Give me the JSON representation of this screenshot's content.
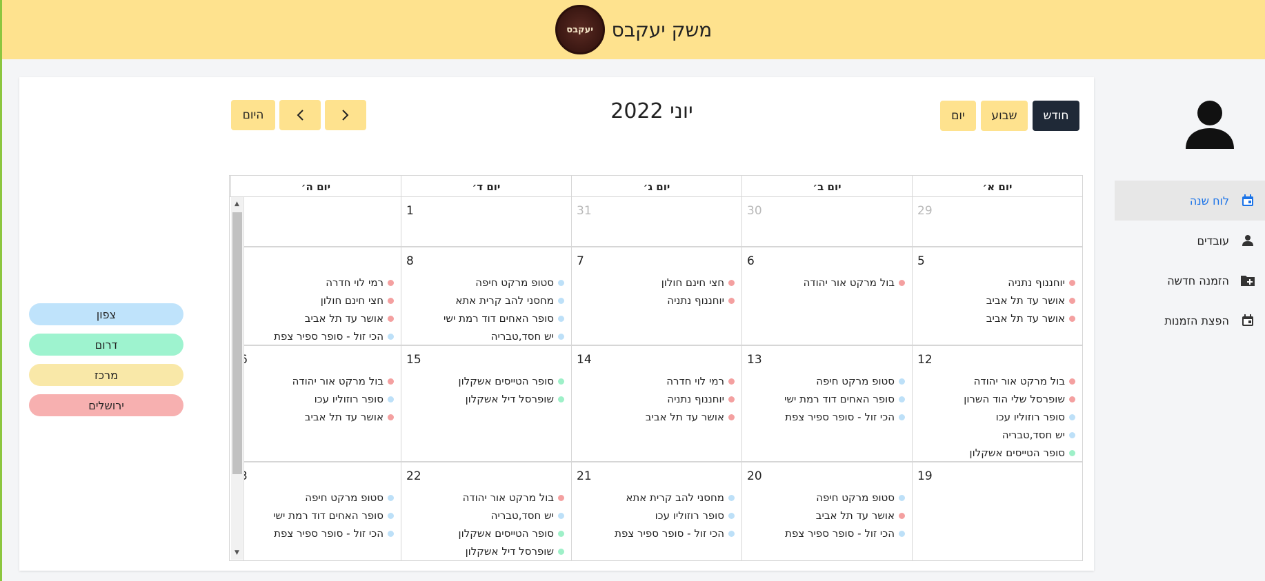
{
  "header": {
    "title": "משק יעקבס",
    "logo_text": "יעקבס"
  },
  "sidebar": {
    "items": [
      {
        "label": "לוח שנה",
        "icon": "calendar-icon",
        "active": true
      },
      {
        "label": "עובדים",
        "icon": "person-icon",
        "active": false
      },
      {
        "label": "הזמנה חדשה",
        "icon": "folder-add-icon",
        "active": false
      },
      {
        "label": "הפצת הזמנות",
        "icon": "event-icon",
        "active": false
      }
    ]
  },
  "toolbar": {
    "month": "חודש",
    "week": "שבוע",
    "day": "יום",
    "title": "יוני 2022",
    "today": "היום"
  },
  "legend": [
    {
      "label": "צפון",
      "color": "#bfe3fb"
    },
    {
      "label": "דרום",
      "color": "#9ef3cf"
    },
    {
      "label": "מרכז",
      "color": "#f9e8a8"
    },
    {
      "label": "ירושלים",
      "color": "#f7b0b0"
    }
  ],
  "colors": {
    "red": "#f4a0a0",
    "blue": "#bde0f8",
    "green": "#9ef0c8"
  },
  "calendar": {
    "headers": [
      "יום א׳",
      "יום ב׳",
      "יום ג׳",
      "יום ד׳",
      "יום ה׳"
    ],
    "weeks": [
      [
        {
          "num": "29",
          "muted": true,
          "events": []
        },
        {
          "num": "30",
          "muted": true,
          "events": []
        },
        {
          "num": "31",
          "muted": true,
          "events": []
        },
        {
          "num": "1",
          "muted": false,
          "events": []
        },
        {
          "num": "",
          "muted": false,
          "events": []
        }
      ],
      [
        {
          "num": "5",
          "events": [
            {
              "t": "יוחננוף נתניה",
              "c": "red"
            },
            {
              "t": "אושר עד תל אביב",
              "c": "red"
            },
            {
              "t": "אושר עד תל אביב",
              "c": "red"
            }
          ]
        },
        {
          "num": "6",
          "events": [
            {
              "t": "בול מרקט אור יהודה",
              "c": "red"
            }
          ]
        },
        {
          "num": "7",
          "events": [
            {
              "t": "חצי חינם חולון",
              "c": "red"
            },
            {
              "t": "יוחננוף נתניה",
              "c": "red"
            }
          ]
        },
        {
          "num": "8",
          "events": [
            {
              "t": "סטופ מרקט חיפה",
              "c": "blue"
            },
            {
              "t": "מחסני להב קרית אתא",
              "c": "blue"
            },
            {
              "t": "סופר האחים דוד רמת ישי",
              "c": "blue"
            },
            {
              "t": "יש חסד,טבריה",
              "c": "blue"
            }
          ]
        },
        {
          "num": "",
          "events": [
            {
              "t": "רמי לוי חדרה",
              "c": "red"
            },
            {
              "t": "חצי חינם חולון",
              "c": "red"
            },
            {
              "t": "אושר עד תל אביב",
              "c": "red"
            },
            {
              "t": "הכי זול - סופר ספיר צפת",
              "c": "blue"
            }
          ]
        }
      ],
      [
        {
          "num": "12",
          "events": [
            {
              "t": "בול מרקט אור יהודה",
              "c": "red"
            },
            {
              "t": "שופרסל שלי הוד השרון",
              "c": "red"
            },
            {
              "t": "סופר רוזוליו עכו",
              "c": "blue"
            },
            {
              "t": "יש חסד,טבריה",
              "c": "blue"
            },
            {
              "t": "סופר הטייסים אשקלון",
              "c": "green"
            }
          ]
        },
        {
          "num": "13",
          "events": [
            {
              "t": "סטופ מרקט חיפה",
              "c": "blue"
            },
            {
              "t": "סופר האחים דוד רמת ישי",
              "c": "blue"
            },
            {
              "t": "הכי זול - סופר ספיר צפת",
              "c": "blue"
            }
          ]
        },
        {
          "num": "14",
          "events": [
            {
              "t": "רמי לוי חדרה",
              "c": "red"
            },
            {
              "t": "יוחננוף נתניה",
              "c": "red"
            },
            {
              "t": "אושר עד תל אביב",
              "c": "red"
            }
          ]
        },
        {
          "num": "15",
          "events": [
            {
              "t": "סופר הטייסים אשקלון",
              "c": "green"
            },
            {
              "t": "שופרסל דיל אשקלון",
              "c": "green"
            }
          ]
        },
        {
          "num": "6",
          "events": [
            {
              "t": "בול מרקט אור יהודה",
              "c": "red"
            },
            {
              "t": "סופר רוזוליו עכו",
              "c": "blue"
            },
            {
              "t": "אושר עד תל אביב",
              "c": "red"
            }
          ]
        }
      ],
      [
        {
          "num": "19",
          "events": []
        },
        {
          "num": "20",
          "events": [
            {
              "t": "סטופ מרקט חיפה",
              "c": "blue"
            },
            {
              "t": "אושר עד תל אביב",
              "c": "red"
            },
            {
              "t": "הכי זול - סופר ספיר צפת",
              "c": "blue"
            }
          ]
        },
        {
          "num": "21",
          "events": [
            {
              "t": "מחסני להב קרית אתא",
              "c": "blue"
            },
            {
              "t": "סופר רוזוליו עכו",
              "c": "blue"
            },
            {
              "t": "הכי זול - סופר ספיר צפת",
              "c": "blue"
            }
          ]
        },
        {
          "num": "22",
          "events": [
            {
              "t": "בול מרקט אור יהודה",
              "c": "red"
            },
            {
              "t": "יש חסד,טבריה",
              "c": "blue"
            },
            {
              "t": "סופר הטייסים אשקלון",
              "c": "green"
            },
            {
              "t": "שופרסל דיל אשקלון",
              "c": "green"
            }
          ]
        },
        {
          "num": "3",
          "events": [
            {
              "t": "סטופ מרקט חיפה",
              "c": "blue"
            },
            {
              "t": "סופר האחים דוד רמת ישי",
              "c": "blue"
            },
            {
              "t": "הכי זול - סופר ספיר צפת",
              "c": "blue"
            }
          ]
        }
      ]
    ]
  }
}
